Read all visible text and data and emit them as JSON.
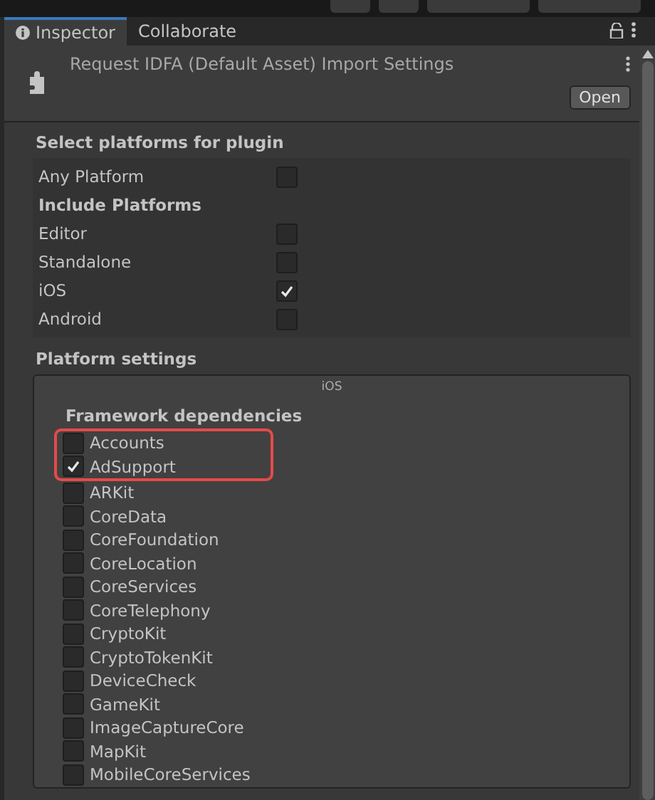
{
  "tabs": [
    {
      "label": "Inspector",
      "selected": true
    },
    {
      "label": "Collaborate",
      "selected": false
    }
  ],
  "header": {
    "title": "Request IDFA (Default Asset) Import Settings",
    "button": "Open"
  },
  "platforms": {
    "heading": "Select platforms for plugin",
    "rows": [
      {
        "kind": "checkbox",
        "label": "Any Platform",
        "checked": false
      },
      {
        "kind": "heading",
        "label": "Include Platforms"
      },
      {
        "kind": "checkbox",
        "label": "Editor",
        "checked": false
      },
      {
        "kind": "checkbox",
        "label": "Standalone",
        "checked": false
      },
      {
        "kind": "checkbox",
        "label": "iOS",
        "checked": true
      },
      {
        "kind": "checkbox",
        "label": "Android",
        "checked": false
      }
    ]
  },
  "platform_settings": {
    "heading": "Platform settings",
    "tab": "iOS",
    "section": "Framework dependencies",
    "groups": [
      {
        "highlighted": true,
        "items": [
          {
            "label": "Accounts",
            "checked": false
          },
          {
            "label": "AdSupport",
            "checked": true
          }
        ]
      },
      {
        "highlighted": false,
        "items": [
          {
            "label": "ARKit",
            "checked": false
          },
          {
            "label": "CoreData",
            "checked": false
          },
          {
            "label": "CoreFoundation",
            "checked": false
          },
          {
            "label": "CoreLocation",
            "checked": false
          },
          {
            "label": "CoreServices",
            "checked": false
          },
          {
            "label": "CoreTelephony",
            "checked": false
          },
          {
            "label": "CryptoKit",
            "checked": false
          },
          {
            "label": "CryptoTokenKit",
            "checked": false
          },
          {
            "label": "DeviceCheck",
            "checked": false
          },
          {
            "label": "GameKit",
            "checked": false
          },
          {
            "label": "ImageCaptureCore",
            "checked": false
          },
          {
            "label": "MapKit",
            "checked": false
          },
          {
            "label": "MobileCoreServices",
            "checked": false
          }
        ]
      }
    ]
  }
}
